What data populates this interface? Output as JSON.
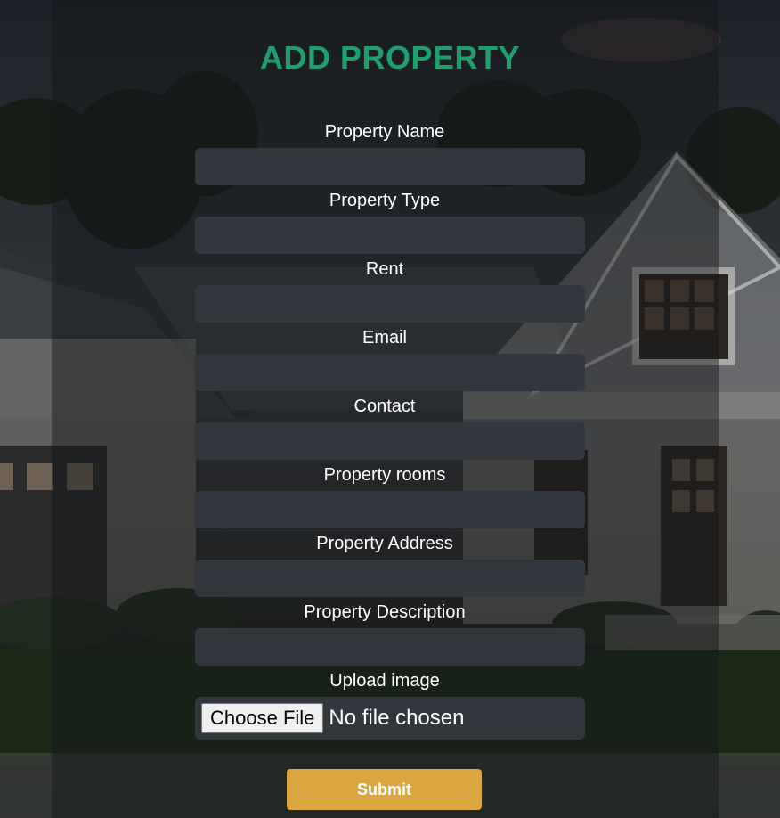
{
  "page": {
    "title": "ADD PROPERTY"
  },
  "form": {
    "fields": [
      {
        "label": "Property Name",
        "value": ""
      },
      {
        "label": "Property Type",
        "value": ""
      },
      {
        "label": "Rent",
        "value": ""
      },
      {
        "label": "Email",
        "value": ""
      },
      {
        "label": "Contact",
        "value": ""
      },
      {
        "label": "Property rooms",
        "value": ""
      },
      {
        "label": "Property Address",
        "value": ""
      },
      {
        "label": "Property Description",
        "value": ""
      }
    ],
    "upload": {
      "label": "Upload image",
      "button_label": "Choose File",
      "status": "No file chosen"
    },
    "submit_label": "Submit"
  },
  "colors": {
    "title": "#1f9e6e",
    "input_bg": "#32373d",
    "submit_bg": "#dba63f"
  }
}
